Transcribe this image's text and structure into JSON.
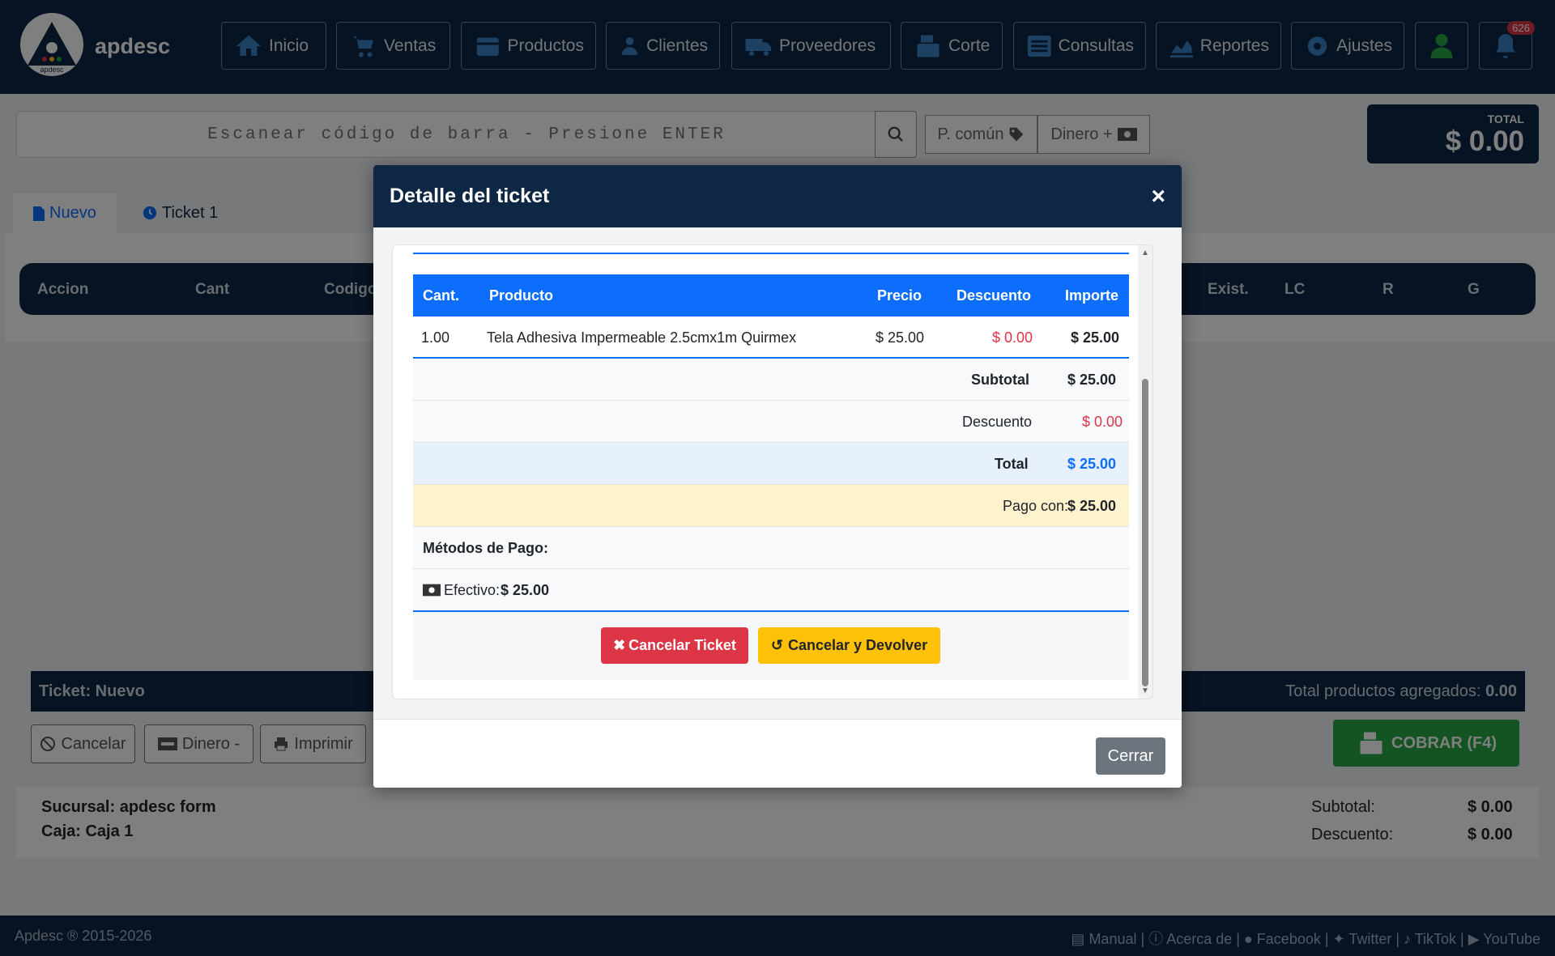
{
  "app": {
    "brand": "apdesc",
    "logo_text": "apdesc"
  },
  "nav": [
    {
      "label": "Inicio",
      "icon": "home-icon"
    },
    {
      "label": "Ventas",
      "icon": "cart-icon"
    },
    {
      "label": "Productos",
      "icon": "box-icon"
    },
    {
      "label": "Clientes",
      "icon": "user-tie-icon"
    },
    {
      "label": "Proveedores",
      "icon": "truck-icon"
    },
    {
      "label": "Corte",
      "icon": "cash-register-icon"
    },
    {
      "label": "Consultas",
      "icon": "list-icon"
    },
    {
      "label": "Reportes",
      "icon": "chart-icon"
    },
    {
      "label": "Ajustes",
      "icon": "gear-icon"
    }
  ],
  "notifications": {
    "count": "626"
  },
  "search": {
    "placeholder": "Escanear código de barra - Presione ENTER"
  },
  "price_type": {
    "label": "P. común"
  },
  "money_in": {
    "label": "Dinero +"
  },
  "total_box": {
    "label": "TOTAL",
    "value": "$ 0.00"
  },
  "tabs": [
    {
      "label": "Nuevo"
    },
    {
      "label": "Ticket 1"
    }
  ],
  "table_headers": [
    "Accion",
    "Cant",
    "Codigo",
    "Exist.",
    "LC",
    "R",
    "G"
  ],
  "ticket_bar": {
    "title": "Ticket: Nuevo",
    "count_label": "Total productos agregados:",
    "count_value": "0.00"
  },
  "bottom_buttons": {
    "cancel": "Cancelar",
    "money_out": "Dinero -",
    "print": "Imprimir",
    "charge": "COBRAR (F4)"
  },
  "info": {
    "branch": "Sucursal: apdesc form",
    "register": "Caja: Caja 1",
    "subtotal_label": "Subtotal:",
    "subtotal_value": "$ 0.00",
    "discount_label": "Descuento:",
    "discount_value": "$ 0.00"
  },
  "footer": {
    "copyright": "Apdesc ® 2015-2026",
    "links": [
      "Manual",
      "Acerca de",
      "Facebook",
      "Twitter",
      "TikTok",
      "YouTube"
    ]
  },
  "modal": {
    "title": "Detalle del ticket",
    "columns": {
      "qty": "Cant.",
      "product": "Producto",
      "price": "Precio",
      "discount": "Descuento",
      "amount": "Importe"
    },
    "items": [
      {
        "qty": "1.00",
        "product": "Tela Adhesiva Impermeable 2.5cmx1m Quirmex",
        "price": "$ 25.00",
        "discount": "$ 0.00",
        "amount": "$ 25.00"
      }
    ],
    "subtotal_label": "Subtotal",
    "subtotal_value": "$ 25.00",
    "discount_label": "Descuento",
    "discount_value": "$ 0.00",
    "total_label": "Total",
    "total_value": "$ 25.00",
    "paid_label": "Pago con:",
    "paid_value": "$ 25.00",
    "payment_methods_label": "Métodos de Pago:",
    "payment_method_label": "Efectivo:",
    "payment_method_value": "$ 25.00",
    "cancel_ticket": "Cancelar Ticket",
    "cancel_return": "Cancelar y Devolver",
    "close": "Cerrar"
  }
}
